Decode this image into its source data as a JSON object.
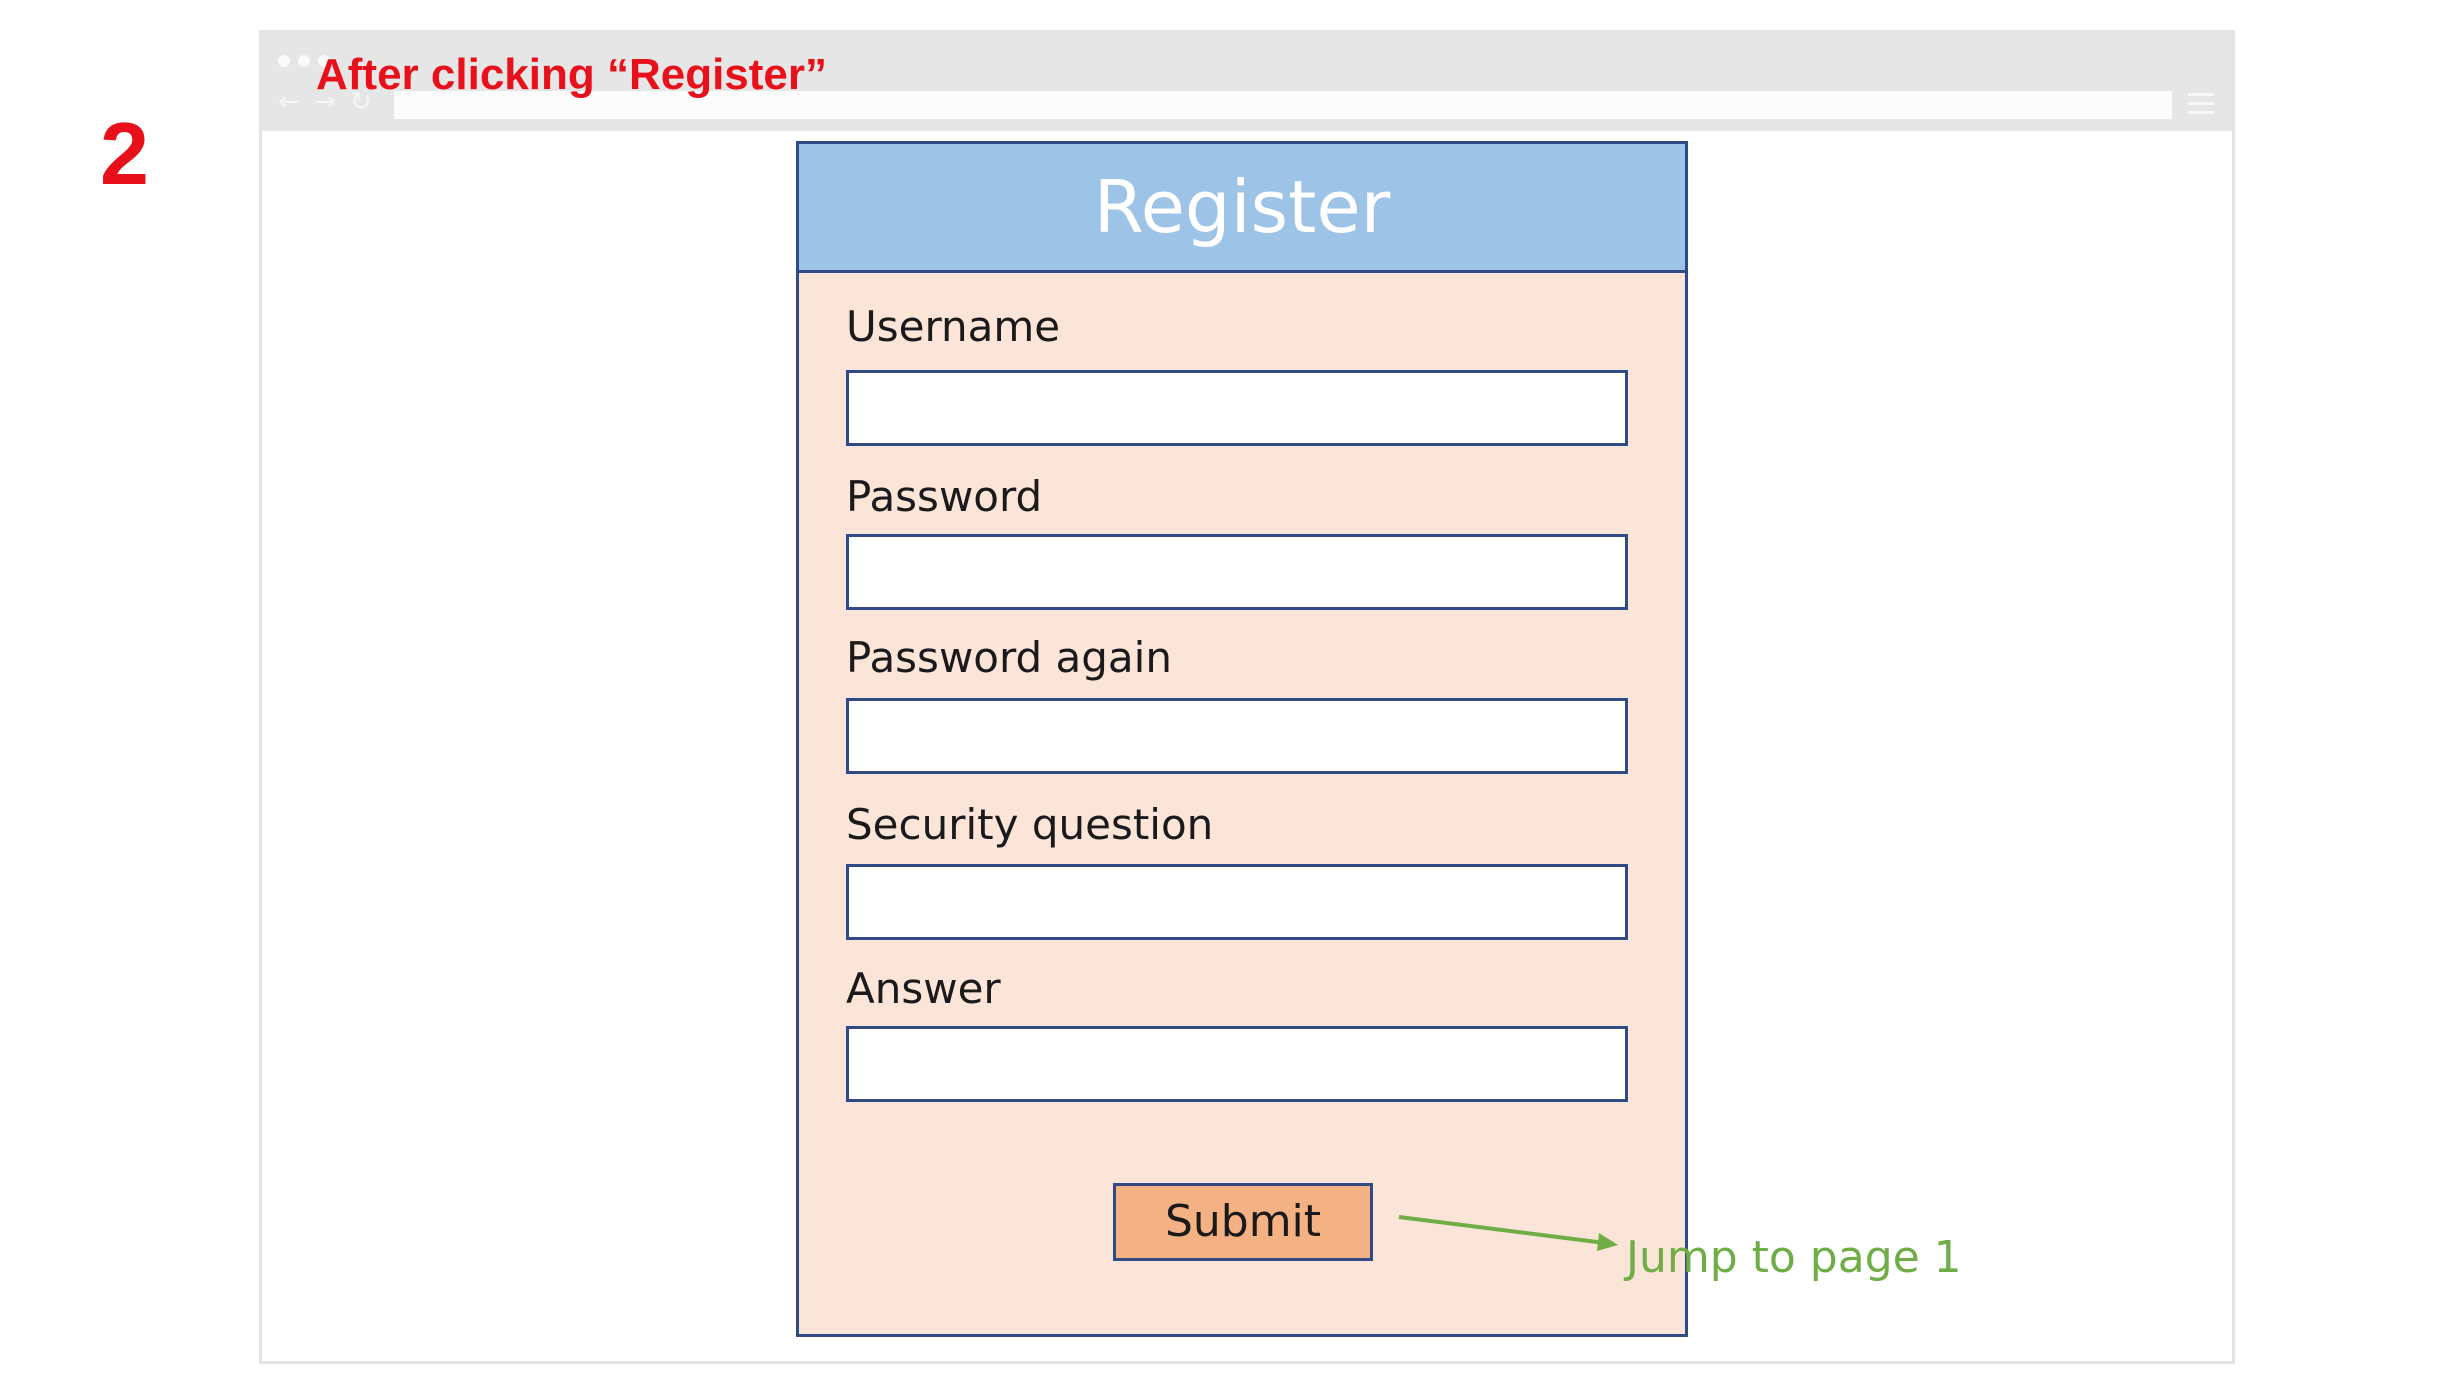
{
  "step_number": "2",
  "caption": "After clicking “Register”",
  "browser": {
    "back_icon": "back-arrow-icon",
    "forward_icon": "forward-arrow-icon",
    "reload_icon": "reload-icon",
    "menu_icon": "hamburger-menu-icon"
  },
  "form": {
    "title": "Register",
    "fields": [
      {
        "label": "Username",
        "value": ""
      },
      {
        "label": "Password",
        "value": ""
      },
      {
        "label": "Password again",
        "value": ""
      },
      {
        "label": "Security question",
        "value": ""
      },
      {
        "label": "Answer",
        "value": ""
      }
    ],
    "submit_label": "Submit"
  },
  "annotation": {
    "text": "Jump to page 1"
  },
  "colors": {
    "step_red": "#e8101a",
    "header_blue": "#9dc3e6",
    "card_fill": "#fbe5d8",
    "border_navy": "#2f4a85",
    "button_orange": "#f4b183",
    "annotation_green": "#70ad47"
  }
}
